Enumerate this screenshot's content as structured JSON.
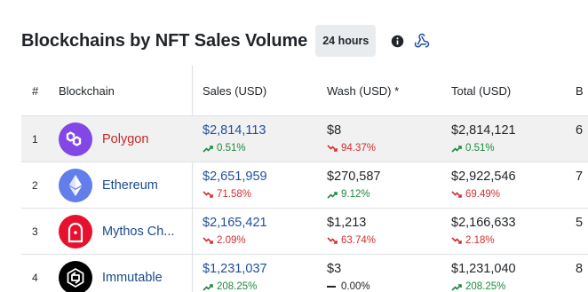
{
  "header": {
    "title": "Blockchains by NFT Sales Volume",
    "period": "24 hours"
  },
  "table": {
    "columns": {
      "rank": "#",
      "blockchain": "Blockchain",
      "sales": "Sales (USD)",
      "wash": "Wash (USD) *",
      "total": "Total (USD)",
      "next": "B"
    },
    "rows": [
      {
        "rank": "1",
        "name": "Polygon",
        "sales": "$2,814,113",
        "sales_change": "0.51%",
        "wash": "$8",
        "wash_change": "94.37%",
        "total": "$2,814,121",
        "total_change": "0.51%",
        "next": "6"
      },
      {
        "rank": "2",
        "name": "Ethereum",
        "sales": "$2,651,959",
        "sales_change": "71.58%",
        "wash": "$270,587",
        "wash_change": "9.12%",
        "total": "$2,922,546",
        "total_change": "69.49%",
        "next": "7"
      },
      {
        "rank": "3",
        "name": "Mythos Ch...",
        "sales": "$2,165,421",
        "sales_change": "2.09%",
        "wash": "$1,213",
        "wash_change": "63.74%",
        "total": "$2,166,633",
        "total_change": "2.18%",
        "next": "5"
      },
      {
        "rank": "4",
        "name": "Immutable",
        "sales": "$1,231,037",
        "sales_change": "208.25%",
        "wash": "$3",
        "wash_change": "0.00%",
        "total": "$1,231,040",
        "total_change": "208.25%",
        "next": "8"
      }
    ]
  },
  "colors": {
    "up": "#1e8a3c",
    "down": "#d32f2f",
    "link": "#1f4f9c",
    "polygon": "#8247e5",
    "ethereum": "#627eea",
    "mythos": "#e8112d",
    "immutable": "#000000"
  },
  "icons": {
    "info": "info-circle-icon",
    "webhook": "webhook-icon",
    "up": "trend-up-icon",
    "down": "trend-down-icon",
    "flat": "dash-icon"
  }
}
